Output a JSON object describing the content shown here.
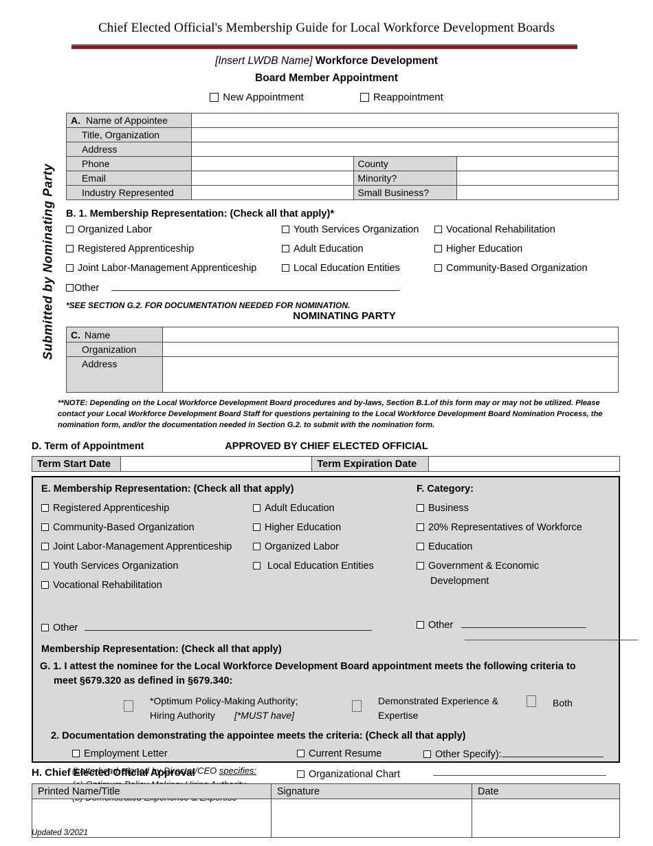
{
  "header": {
    "doc_title": "Chief Elected Official's Membership Guide for Local Workforce Development Boards",
    "subtitle_italic": "[Insert LWDB Name]",
    "subtitle_bold": " Workforce Development",
    "subtitle2": "Board  Member Appointment",
    "appointment_options": [
      {
        "label": "New Appointment"
      },
      {
        "label": "Reappointment"
      }
    ],
    "rule_color": "#7b2228"
  },
  "sidebar": {
    "vertical_label": "Submitted by Nominating Party"
  },
  "section_a": {
    "letter": "A.",
    "rows": [
      {
        "label": "Name of Appointee"
      },
      {
        "label": "Title, Organization"
      },
      {
        "label": "Address"
      },
      {
        "label": "Phone",
        "mid_label": "County"
      },
      {
        "label": "Email",
        "mid_label": "Minority?"
      },
      {
        "label": "Industry Represented",
        "mid_label": "Small Business?"
      }
    ]
  },
  "section_b": {
    "heading": "B. 1. Membership Representation:  (Check all that apply)*",
    "col1": [
      "Organized Labor",
      "Registered Apprenticeship",
      "Joint Labor-Management Apprenticeship"
    ],
    "col2": [
      "Youth Services Organization",
      "Adult Education",
      "Local Education Entities"
    ],
    "col3": [
      "Vocational Rehabilitation",
      "Higher Education",
      "Community-Based Organization"
    ],
    "other_label": "Other",
    "note": "*SEE SECTION G.2. FOR DOCUMENTATION NEEDED FOR NOMINATION."
  },
  "nominating_party": {
    "title": "NOMINATING PARTY",
    "letter": "C.",
    "rows": [
      {
        "label": "Name"
      },
      {
        "label": "Organization"
      },
      {
        "label": "Address"
      }
    ],
    "note": "**NOTE:  Depending on the Local Workforce Development Board procedures and by-laws, Section B.1.of this form may or may not be utilized.  Please contact your Local Workforce Development Board Staff for questions pertaining to the Local Workforce Development Board Nomination Process, the nomination form, and/or the documentation needed in Section G.2.  to submit with the nomination form."
  },
  "section_d": {
    "heading": "D. Term of Appointment",
    "approved_by": "APPROVED BY CHIEF ELECTED OFFICIAL",
    "term_start_label": "Term Start Date",
    "term_start_value": "",
    "term_expiration_label": "Term Expiration Date",
    "term_expiration_value": ""
  },
  "section_e": {
    "heading": "E. Membership Representation:  (Check all that apply)",
    "col1": [
      "Registered Apprenticeship",
      "Community-Based Organization",
      "Joint Labor-Management Apprenticeship",
      "Youth Services Organization",
      "Vocational Rehabilitation"
    ],
    "col2": [
      "Adult Education",
      "Higher Education",
      "Organized Labor",
      " Local Education Entities"
    ],
    "other_label": "Other"
  },
  "section_f": {
    "heading": "F. Category:",
    "items": [
      "Business",
      "20% Representatives of Workforce",
      "Education"
    ],
    "gov_item": "Government & Economic",
    "gov_item_cont": "Development",
    "other_label": "Other"
  },
  "section_g": {
    "membership_heading": "Membership Representation:  (Check all that apply)",
    "g1_line1": "G. 1.  I attest the nominee for the Local Workforce Development Board appointment meets the following criteria to",
    "g1_line2": "meet §679.320 as defined in §679.340:",
    "opt1_line1": "*Optimum Policy-Making Authority;",
    "opt1_line2": "Hiring Authority",
    "opt1_must": "[*MUST have]",
    "opt2_line1": "Demonstrated Experience &",
    "opt2_line2": "Expertise",
    "opt3": "Both",
    "g2_heading": "2.  Documentation demonstrating the appointee meets the criteria:  (Check all that apply)",
    "doc_col1_item": "Employment Letter",
    "doc_col1_note_a": "(Letterhead, signed by Director/CEO ",
    "doc_col1_note_a_u": "specifies:",
    "doc_col1_note_b": "(a) Optimum Policy-Making; Hiring Authority",
    "doc_col1_note_c": "(b) Demonstrated Experience & Expertise",
    "doc_col2": [
      "Current Resume",
      "Organizational Chart"
    ],
    "doc_col3_label": "Other Specify):"
  },
  "section_h": {
    "heading": "H. Chief Elected Official Approval",
    "columns": [
      "Printed Name/Title",
      "Signature",
      "Date"
    ],
    "values": [
      "",
      "",
      ""
    ]
  },
  "footer": {
    "updated": "Updated 3/2021"
  }
}
